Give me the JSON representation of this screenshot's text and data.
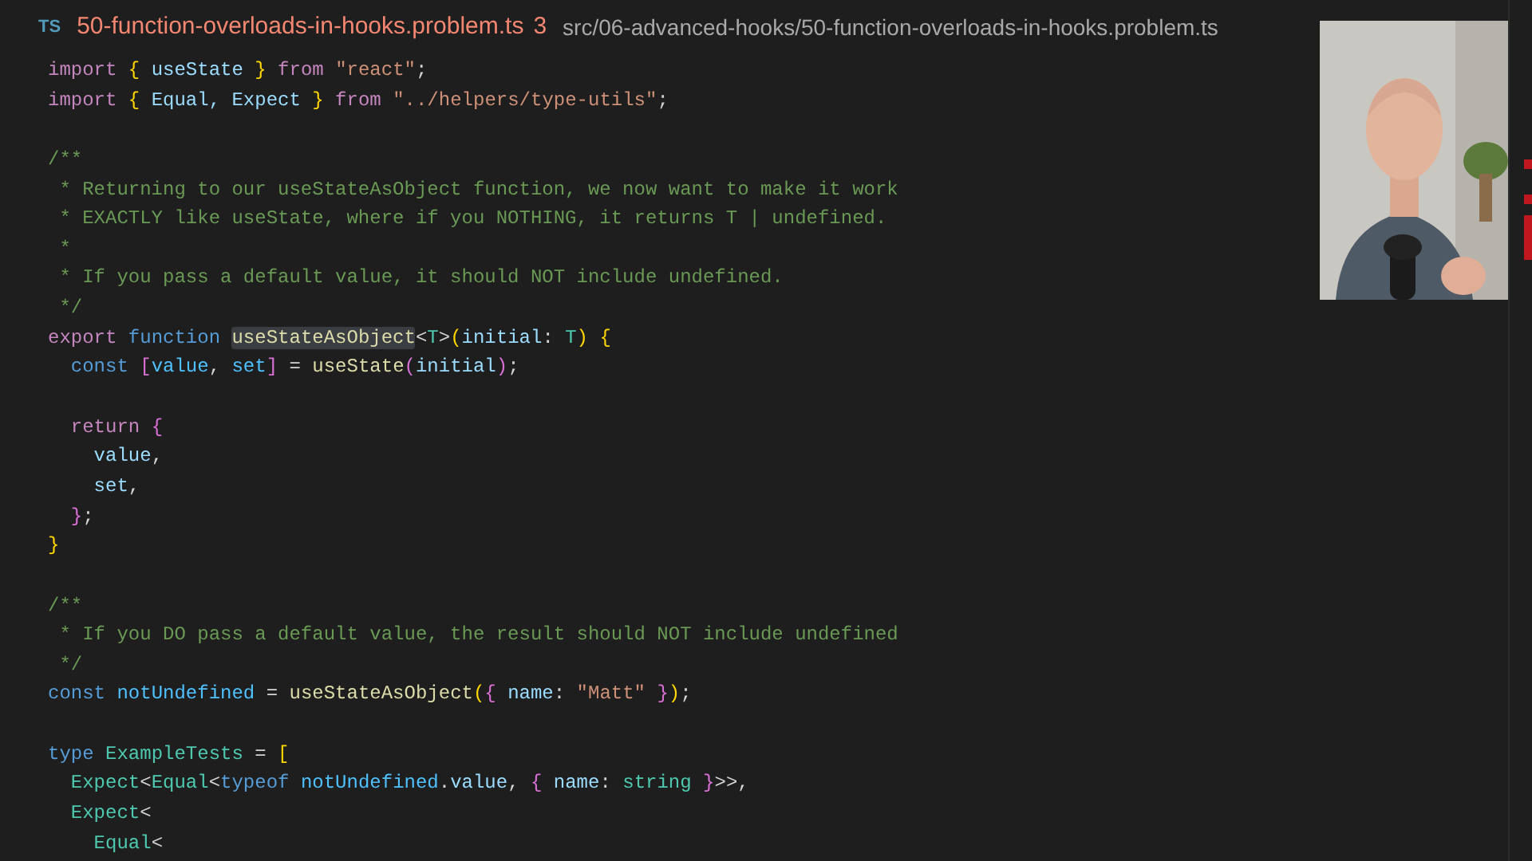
{
  "breadcrumb": {
    "file_type": "TS",
    "file_name": "50-function-overloads-in-hooks.problem.ts",
    "has_errors": true,
    "error_count": "3",
    "path": "src/06-advanced-hooks/50-function-overloads-in-hooks.problem.ts"
  },
  "code_lines": [
    {
      "kind": "code",
      "tokens": [
        {
          "text": "import ",
          "kind": "kw"
        },
        {
          "text": "{",
          "kind": "b1"
        },
        {
          "text": " useState ",
          "kind": "var"
        },
        {
          "text": "}",
          "kind": "b1"
        },
        {
          "text": " from ",
          "kind": "kw"
        },
        {
          "text": "\"react\"",
          "kind": "str"
        },
        {
          "text": ";",
          "kind": "plain"
        }
      ]
    },
    {
      "kind": "code",
      "tokens": [
        {
          "text": "import ",
          "kind": "kw"
        },
        {
          "text": "{",
          "kind": "b1"
        },
        {
          "text": " Equal, Expect ",
          "kind": "var"
        },
        {
          "text": "}",
          "kind": "b1"
        },
        {
          "text": " from ",
          "kind": "kw"
        },
        {
          "text": "\"../helpers/type-utils\"",
          "kind": "str"
        },
        {
          "text": ";",
          "kind": "plain"
        }
      ]
    },
    {
      "kind": "blank"
    },
    {
      "kind": "code",
      "tokens": [
        {
          "text": "/**",
          "kind": "comment"
        }
      ]
    },
    {
      "kind": "code",
      "tokens": [
        {
          "text": " * Returning to our useStateAsObject function, we now want to make it work",
          "kind": "comment"
        }
      ]
    },
    {
      "kind": "code",
      "tokens": [
        {
          "text": " * EXACTLY like useState, where if you NOTHING, it returns T | undefined.",
          "kind": "comment"
        }
      ]
    },
    {
      "kind": "code",
      "tokens": [
        {
          "text": " *",
          "kind": "comment"
        }
      ]
    },
    {
      "kind": "code",
      "tokens": [
        {
          "text": " * If you pass a default value, it should NOT include undefined.",
          "kind": "comment"
        }
      ]
    },
    {
      "kind": "code",
      "tokens": [
        {
          "text": " */",
          "kind": "comment"
        }
      ]
    },
    {
      "kind": "code",
      "tokens": [
        {
          "text": "export ",
          "kind": "kw"
        },
        {
          "text": "function ",
          "kind": "storage"
        },
        {
          "text": "useStateAsObject",
          "kind": "fn-highlight"
        },
        {
          "text": "<",
          "kind": "plain"
        },
        {
          "text": "T",
          "kind": "type"
        },
        {
          "text": ">",
          "kind": "plain"
        },
        {
          "text": "(",
          "kind": "b1"
        },
        {
          "text": "initial",
          "kind": "var"
        },
        {
          "text": ": ",
          "kind": "plain"
        },
        {
          "text": "T",
          "kind": "type"
        },
        {
          "text": ")",
          "kind": "b1"
        },
        {
          "text": " {",
          "kind": "b1"
        }
      ]
    },
    {
      "kind": "code",
      "tokens": [
        {
          "text": "  const ",
          "kind": "storage"
        },
        {
          "text": "[",
          "kind": "b2"
        },
        {
          "text": "value",
          "kind": "const"
        },
        {
          "text": ", ",
          "kind": "plain"
        },
        {
          "text": "set",
          "kind": "const"
        },
        {
          "text": "]",
          "kind": "b2"
        },
        {
          "text": " = ",
          "kind": "plain"
        },
        {
          "text": "useState",
          "kind": "fn"
        },
        {
          "text": "(",
          "kind": "b2"
        },
        {
          "text": "initial",
          "kind": "var"
        },
        {
          "text": ")",
          "kind": "b2"
        },
        {
          "text": ";",
          "kind": "plain"
        }
      ]
    },
    {
      "kind": "blank"
    },
    {
      "kind": "code",
      "tokens": [
        {
          "text": "  return ",
          "kind": "kw"
        },
        {
          "text": "{",
          "kind": "b2"
        }
      ]
    },
    {
      "kind": "code",
      "tokens": [
        {
          "text": "    value",
          "kind": "var"
        },
        {
          "text": ",",
          "kind": "plain"
        }
      ]
    },
    {
      "kind": "code",
      "tokens": [
        {
          "text": "    set",
          "kind": "var"
        },
        {
          "text": ",",
          "kind": "plain"
        }
      ]
    },
    {
      "kind": "code",
      "tokens": [
        {
          "text": "  }",
          "kind": "b2"
        },
        {
          "text": ";",
          "kind": "plain"
        }
      ]
    },
    {
      "kind": "code",
      "tokens": [
        {
          "text": "}",
          "kind": "b1"
        }
      ]
    },
    {
      "kind": "blank"
    },
    {
      "kind": "code",
      "tokens": [
        {
          "text": "/**",
          "kind": "comment"
        }
      ]
    },
    {
      "kind": "code",
      "tokens": [
        {
          "text": " * If you DO pass a default value, the result should NOT include undefined",
          "kind": "comment"
        }
      ]
    },
    {
      "kind": "code",
      "tokens": [
        {
          "text": " */",
          "kind": "comment"
        }
      ]
    },
    {
      "kind": "code",
      "tokens": [
        {
          "text": "const ",
          "kind": "storage"
        },
        {
          "text": "notUndefined",
          "kind": "const"
        },
        {
          "text": " = ",
          "kind": "plain"
        },
        {
          "text": "useStateAsObject",
          "kind": "fn"
        },
        {
          "text": "(",
          "kind": "b1"
        },
        {
          "text": "{",
          "kind": "b2"
        },
        {
          "text": " name",
          "kind": "var"
        },
        {
          "text": ": ",
          "kind": "plain"
        },
        {
          "text": "\"Matt\"",
          "kind": "str"
        },
        {
          "text": " }",
          "kind": "b2"
        },
        {
          "text": ")",
          "kind": "b1"
        },
        {
          "text": ";",
          "kind": "plain"
        }
      ]
    },
    {
      "kind": "blank"
    },
    {
      "kind": "code",
      "tokens": [
        {
          "text": "type ",
          "kind": "storage"
        },
        {
          "text": "ExampleTests",
          "kind": "type"
        },
        {
          "text": " = ",
          "kind": "plain"
        },
        {
          "text": "[",
          "kind": "b1"
        }
      ]
    },
    {
      "kind": "code",
      "tokens": [
        {
          "text": "  Expect",
          "kind": "type"
        },
        {
          "text": "<",
          "kind": "plain"
        },
        {
          "text": "Equal",
          "kind": "type"
        },
        {
          "text": "<",
          "kind": "plain"
        },
        {
          "text": "typeof ",
          "kind": "storage"
        },
        {
          "text": "notUndefined",
          "kind": "const"
        },
        {
          "text": ".",
          "kind": "plain"
        },
        {
          "text": "value",
          "kind": "var"
        },
        {
          "text": ", ",
          "kind": "plain"
        },
        {
          "text": "{",
          "kind": "b2"
        },
        {
          "text": " name",
          "kind": "var"
        },
        {
          "text": ": ",
          "kind": "plain"
        },
        {
          "text": "string",
          "kind": "type"
        },
        {
          "text": " }",
          "kind": "b2"
        },
        {
          "text": ">>,",
          "kind": "plain"
        }
      ]
    },
    {
      "kind": "code",
      "tokens": [
        {
          "text": "  Expect",
          "kind": "type"
        },
        {
          "text": "<",
          "kind": "plain"
        }
      ]
    },
    {
      "kind": "code",
      "tokens": [
        {
          "text": "    Equal",
          "kind": "type"
        },
        {
          "text": "<",
          "kind": "plain"
        }
      ]
    }
  ]
}
